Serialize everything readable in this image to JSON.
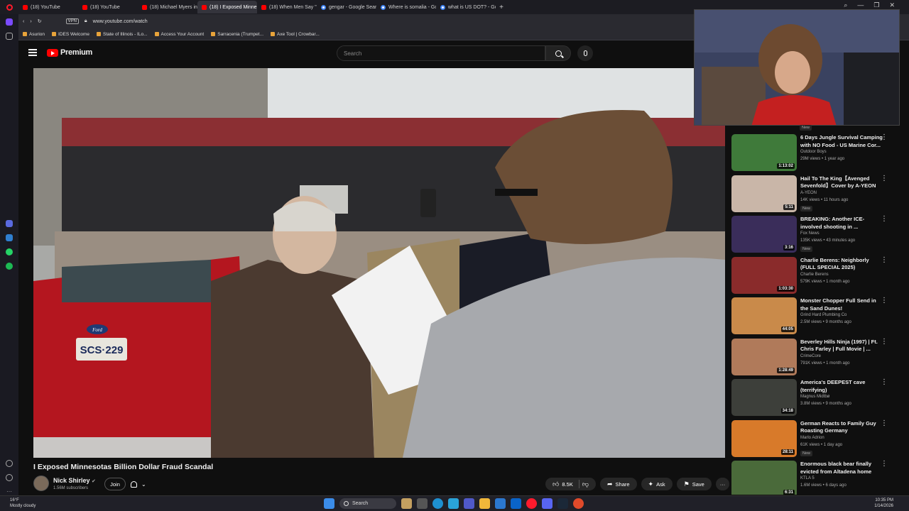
{
  "browser": {
    "tabs": [
      {
        "label": "(18) YouTube",
        "icon": "youtube-icon",
        "active": false
      },
      {
        "label": "(18) YouTube",
        "icon": "youtube-icon",
        "active": false
      },
      {
        "label": "(18) Michael Myers inter...",
        "icon": "youtube-icon",
        "active": false
      },
      {
        "label": "(18) I Exposed Minne...",
        "icon": "youtube-icon",
        "active": true
      },
      {
        "label": "(18) When Men Say \"Be R...",
        "icon": "youtube-icon",
        "active": false
      },
      {
        "label": "gengar - Google Search",
        "icon": "google-icon",
        "active": false
      },
      {
        "label": "Where is somalia - Googl...",
        "icon": "google-icon",
        "active": false
      },
      {
        "label": "what is US DOT? - Googl...",
        "icon": "google-icon",
        "active": false
      }
    ],
    "url": "www.youtube.com/watch",
    "vpn_label": "VPN",
    "bookmarks": [
      "Asurion",
      "IDES Welcome",
      "State of Illinois - ILo...",
      "Access Your Account",
      "Sarracenia (Trumpet...",
      "Axe Tool | Crowbar..."
    ]
  },
  "header": {
    "logo_text": "Premium",
    "search_placeholder": "Search"
  },
  "video": {
    "title": "I Exposed Minnesotas Billion Dollar Fraud Scandal",
    "license_plate": "SCS·229",
    "car_badge": "Ford",
    "channel_name": "Nick Shirley",
    "subscribers": "1.56M subscribers",
    "join_label": "Join",
    "likes": "8.5K",
    "share_label": "Share",
    "ask_label": "Ask",
    "save_label": "Save",
    "more_label": "···"
  },
  "recommendations": {
    "top_badge": "New",
    "items": [
      {
        "title": "6 Days Jungle Survival Camping with NO Food - US Marine Cor...",
        "channel": "Outdoor Boys",
        "meta": "29M views • 1 year ago",
        "duration": "1:13:02",
        "badge": "",
        "thumb": "#3f7a3a"
      },
      {
        "title": "Hail To The King【Avenged Sevenfold】Cover by A-YEON",
        "channel": "A-YEON",
        "meta": "14K views • 11 hours ago",
        "duration": "5:11",
        "badge": "New",
        "thumb": "#c9b6a8"
      },
      {
        "title": "BREAKING: Another ICE-involved shooting in ...",
        "channel": "Fox News",
        "meta": "135K views • 43 minutes ago",
        "duration": "3:16",
        "badge": "New",
        "thumb": "#3a2d5a"
      },
      {
        "title": "Charlie Berens: Neighborly (FULL SPECIAL 2025)",
        "channel": "Charlie Berens",
        "meta": "579K views • 1 month ago",
        "duration": "1:03:30",
        "badge": "",
        "thumb": "#8a2b2b"
      },
      {
        "title": "Monster Chopper Full Send in the Sand Dunes!",
        "channel": "Grind Hard Plumbing Co",
        "meta": "2.5M views • 9 months ago",
        "duration": "44:05",
        "badge": "",
        "thumb": "#c98a4a"
      },
      {
        "title": "Beverley Hills Ninja (1997) | Ft. Chris Farley | Full Movie | ...",
        "channel": "CrimeCore",
        "meta": "791K views • 1 month ago",
        "duration": "1:28:49",
        "badge": "",
        "thumb": "#b07a5a"
      },
      {
        "title": "America's DEEPEST cave (terrifying)",
        "channel": "Magnus Midtbø",
        "meta": "3.8M views • 9 months ago",
        "duration": "34:18",
        "badge": "",
        "thumb": "#3d3f3a"
      },
      {
        "title": "German Reacts to Family Guy Roasting Germany",
        "channel": "Marlo Adrion",
        "meta": "61K views • 1 day ago",
        "duration": "28:11",
        "badge": "New",
        "thumb": "#d87a2a"
      },
      {
        "title": "Enormous black bear finally evicted from Altadena home",
        "channel": "KTLA 5",
        "meta": "1.6M views • 6 days ago",
        "duration": "6:31",
        "badge": "",
        "thumb": "#4a6a3a"
      }
    ]
  },
  "taskbar": {
    "temperature": "16°F",
    "weather": "Mostly cloudy",
    "search_label": "Search",
    "time": "10:35 PM",
    "date": "1/14/2026"
  }
}
